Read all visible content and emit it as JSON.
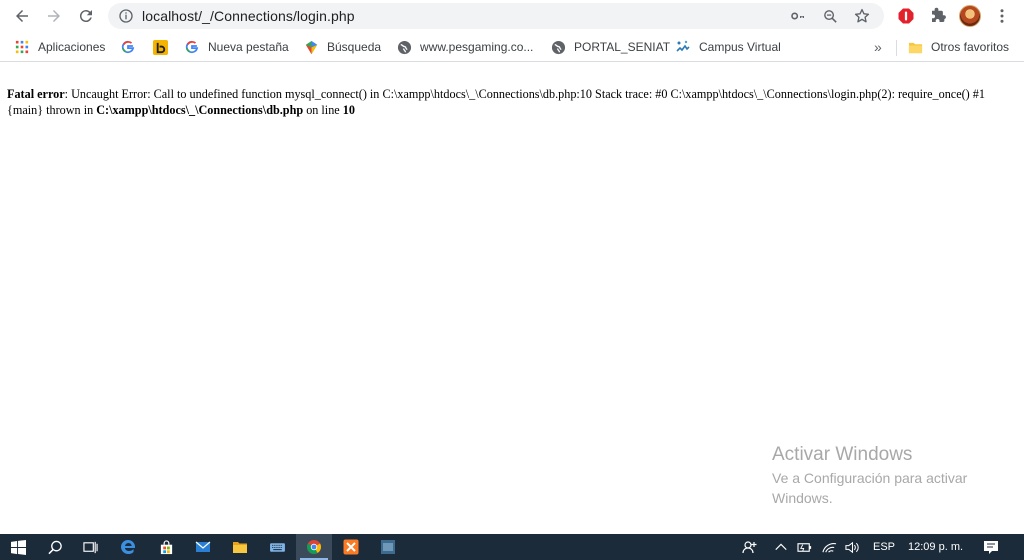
{
  "browser": {
    "url": "localhost/_/Connections/login.php",
    "bookmarks": [
      {
        "label": "Aplicaciones",
        "icon": "apps-grid-icon"
      },
      {
        "label": "",
        "icon": "google-icon"
      },
      {
        "label": "",
        "icon": "bookmark-app-icon"
      },
      {
        "label": "Nueva pestaña",
        "icon": "google-icon"
      },
      {
        "label": "Búsqueda",
        "icon": "search-app-icon"
      },
      {
        "label": "www.pesgaming.co...",
        "icon": "globe-icon"
      },
      {
        "label": "PORTAL_SENIAT",
        "icon": "globe-icon"
      },
      {
        "label": "Campus Virtual",
        "icon": "campus-icon"
      }
    ],
    "overflow_label": "»",
    "other_bookmarks": "Otros favoritos"
  },
  "page": {
    "error_label": "Fatal error",
    "error_text_1": ": Uncaught Error: Call to undefined function mysql_connect() in C:\\xampp\\htdocs\\_\\Connections\\db.php:10 Stack trace: #0 C:\\xampp\\htdocs\\_\\Connections\\login.php(2): require_once() #1 {main} thrown in ",
    "error_file": "C:\\xampp\\htdocs\\_\\Connections\\db.php",
    "error_text_2": " on line ",
    "error_line": "10"
  },
  "watermark": {
    "title": "Activar Windows",
    "subtitle": "Ve a Configuración para activar Windows."
  },
  "taskbar": {
    "language": "ESP",
    "time": "12:09 p. m."
  }
}
